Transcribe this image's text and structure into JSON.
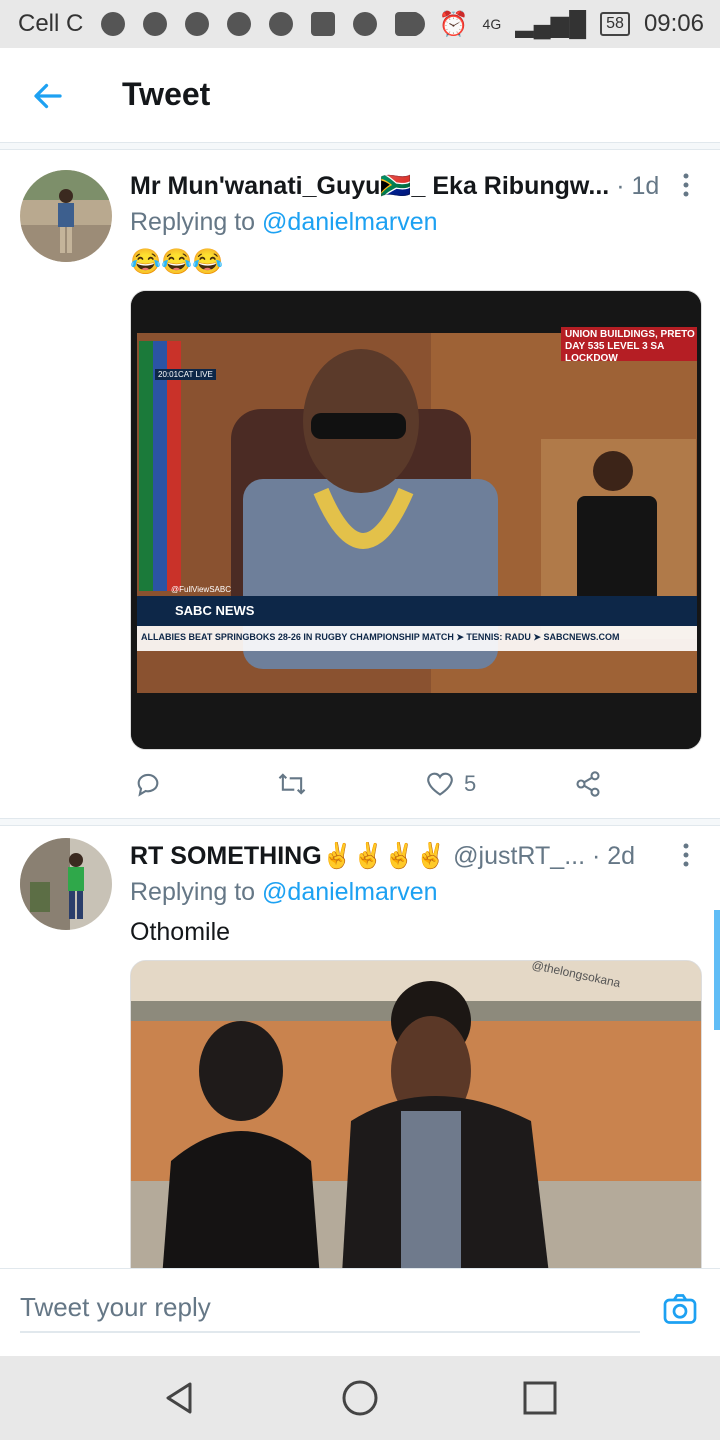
{
  "status_bar": {
    "carrier": "Cell C",
    "signal": "4G",
    "battery": "58",
    "time": "09:06"
  },
  "header": {
    "title": "Tweet",
    "back_icon": "arrow-left-icon",
    "accent_color": "#1da1f2"
  },
  "tweets": [
    {
      "name": "Mr Mun'wanati_Guyu🇿🇦_ Eka Ribungw...",
      "time": "· 1d",
      "reply_prefix": "Replying to",
      "reply_to": "@danielmarven",
      "text": "😂😂😂",
      "media_overlay": {
        "badge_line1": "UNION BUILDINGS, PRETO",
        "badge_line2": "DAY 535 LEVEL 3 SA LOCKDOW",
        "live": "20:01CAT  LIVE",
        "source": "@FullViewSABC",
        "channel": "SABC NEWS",
        "ticker": "ALLABIES BEAT SPRINGBOKS 28-26 IN RUGBY CHAMPIONSHIP MATCH ➤ TENNIS: RADU ➤ SABCNEWS.COM"
      },
      "likes": "5"
    },
    {
      "name": "RT SOMETHING✌✌✌✌",
      "handle": "@justRT_...",
      "time": "· 2d",
      "reply_prefix": "Replying to",
      "reply_to": "@danielmarven",
      "text": "Othomile",
      "media_overlay": {
        "watermark": "@thelongsokana"
      }
    }
  ],
  "composer": {
    "placeholder": "Tweet your reply"
  }
}
